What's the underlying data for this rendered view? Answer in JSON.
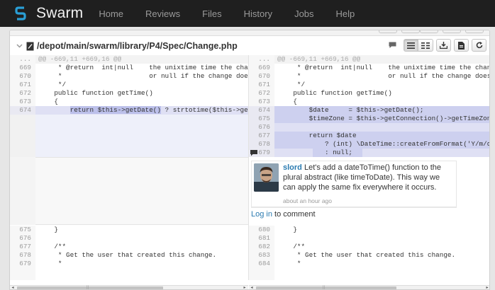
{
  "app": {
    "brand": "Swarm",
    "nav": [
      "Home",
      "Reviews",
      "Files",
      "History",
      "Jobs",
      "Help"
    ]
  },
  "file": {
    "path": "/depot/main/swarm/library/P4/Spec/Change.php",
    "tools": [
      "comment-icon",
      "inline-diff-icon",
      "side-by-side-icon",
      "download-icon",
      "file-icon",
      "refresh-icon"
    ]
  },
  "diff": {
    "hunk_header_left_ln": "...",
    "hunk_header_right_ln": "...",
    "hunk_header": "@@ -669,11 +669,16 @@",
    "left_context": [
      {
        "ln": "669",
        "text": "     * @return  int|null    the unixtime time the change was l"
      },
      {
        "ln": "670",
        "text": "     *                      or null if the change does not"
      },
      {
        "ln": "671",
        "text": "     */"
      },
      {
        "ln": "672",
        "text": "    public function getTime()"
      },
      {
        "ln": "673",
        "text": "    {"
      }
    ],
    "right_context": [
      {
        "ln": "669",
        "text": "     * @return  int|null    the unixtime time the change was l"
      },
      {
        "ln": "670",
        "text": "     *                      or null if the change does not"
      },
      {
        "ln": "671",
        "text": "     */"
      },
      {
        "ln": "672",
        "text": "    public function getTime()"
      },
      {
        "ln": "673",
        "text": "    {"
      }
    ],
    "left_changed": {
      "ln": "674",
      "indent": "        ",
      "hl": "return $this->getDate()",
      "rest": " ? strtotime($this->getDate"
    },
    "right_changed": [
      {
        "ln": "674",
        "text": "        $date     = $this->getDate();"
      },
      {
        "ln": "675",
        "text": "        $timeZone = $this->getConnection()->getTimeZone();"
      },
      {
        "ln": "676",
        "text": ""
      },
      {
        "ln": "677",
        "text": "        return $date"
      },
      {
        "ln": "678",
        "text": "            ? (int) \\DateTime::createFromFormat('Y/m/d H:i"
      },
      {
        "ln": "679",
        "text": "            : null;"
      }
    ],
    "left_after": [
      {
        "ln": "675",
        "text": "    }"
      },
      {
        "ln": "676",
        "text": ""
      },
      {
        "ln": "677",
        "text": "    /**"
      },
      {
        "ln": "678",
        "text": "     * Get the user that created this change."
      },
      {
        "ln": "679",
        "text": "     *"
      }
    ],
    "right_after": [
      {
        "ln": "680",
        "text": "    }"
      },
      {
        "ln": "681",
        "text": ""
      },
      {
        "ln": "682",
        "text": "    /**"
      },
      {
        "ln": "683",
        "text": "     * Get the user that created this change."
      },
      {
        "ln": "684",
        "text": "     *"
      }
    ]
  },
  "comment": {
    "user": "slord",
    "body": " Let's add a dateToTime() function to the plural abstract (like timeToDate). This way we can apply the same fix everywhere it occurs.",
    "time": "about an hour ago",
    "login_link": "Log in",
    "login_suffix": " to comment"
  },
  "scrollbars": {
    "grip": "||"
  }
}
